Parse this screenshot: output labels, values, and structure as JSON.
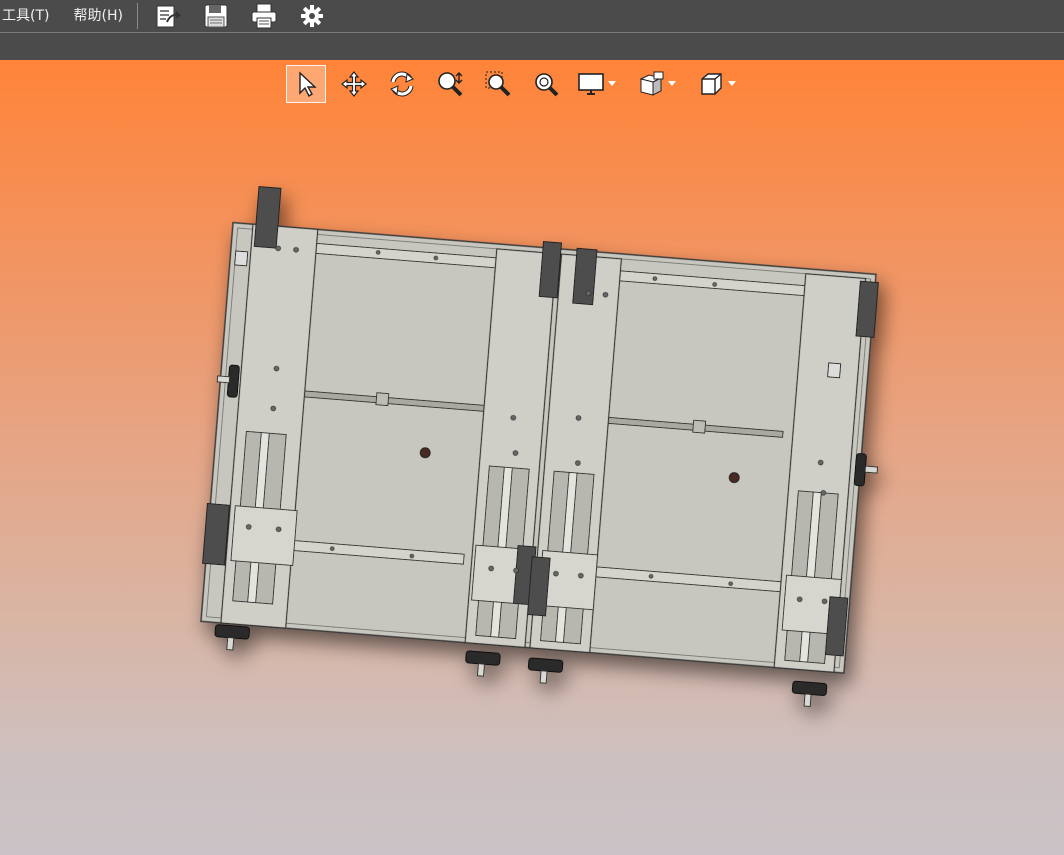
{
  "menubar": {
    "items": [
      {
        "label": "工具(T)"
      },
      {
        "label": "帮助(H)"
      }
    ],
    "toolbar": [
      {
        "icon": "open-document-icon"
      },
      {
        "icon": "save-icon"
      },
      {
        "icon": "print-icon"
      },
      {
        "icon": "gear-icon"
      }
    ]
  },
  "view_toolbar": {
    "tools": [
      {
        "icon": "select-arrow-icon",
        "active": true
      },
      {
        "icon": "pan-move-icon"
      },
      {
        "icon": "rotate-icon"
      },
      {
        "icon": "zoom-icon"
      },
      {
        "icon": "zoom-window-icon"
      },
      {
        "icon": "zoom-fit-icon"
      },
      {
        "icon": "display-monitor-icon",
        "dropdown": true
      },
      {
        "icon": "display-style-icon",
        "dropdown": true
      },
      {
        "icon": "view-cube-icon",
        "dropdown": true
      }
    ]
  },
  "colors": {
    "menubar_bg": "#4b4b4b",
    "viewport_top": "#ff8438",
    "viewport_bottom": "#cac2c6",
    "model_plate": "#c8c7bf",
    "model_dark": "#4e4e4e"
  }
}
